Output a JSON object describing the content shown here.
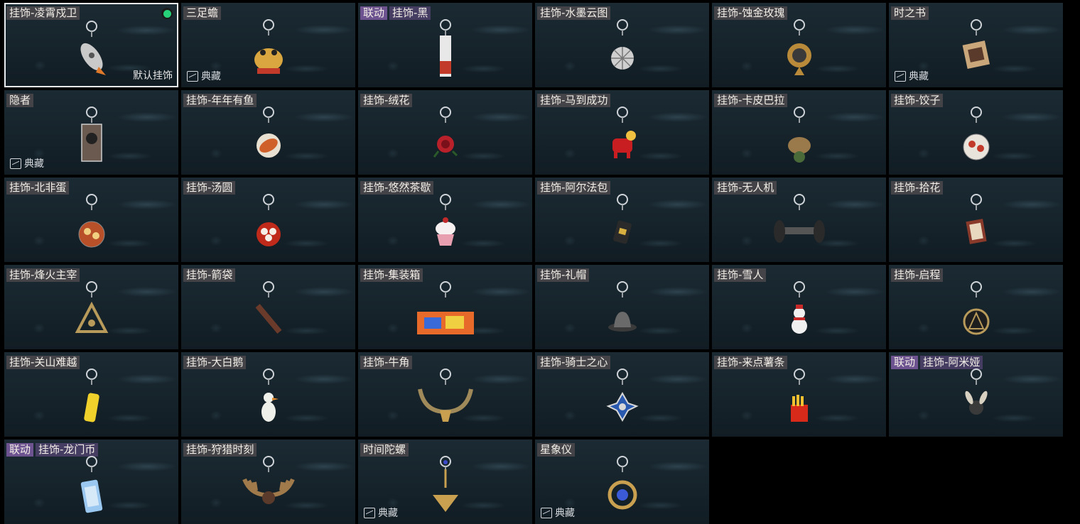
{
  "cards": [
    {
      "label": "挂饰-凌霄戍卫",
      "selected": true,
      "equipped": true,
      "default_label": "默认挂饰",
      "icon": "rocket-charm-icon",
      "color": "#c9c9c9",
      "accent": "#e07a2a",
      "shape": "rocket"
    },
    {
      "label": "三足蟾",
      "corner": "典藏",
      "icon": "golden-toad-charm-icon",
      "color": "#d9a640",
      "accent": "#c23a2a",
      "shape": "toad"
    },
    {
      "collab": "联动",
      "label": "挂饰-黑",
      "icon": "tall-box-charm-icon",
      "color": "#e8e8e8",
      "accent": "#c23a2a",
      "shape": "tall"
    },
    {
      "label": "挂饰-水墨云图",
      "icon": "disco-ball-charm-icon",
      "color": "#cfcfcf",
      "accent": "#777777",
      "shape": "ball"
    },
    {
      "label": "挂饰-蚀金玫瑰",
      "icon": "gold-rose-badge-charm-icon",
      "color": "#b88a3a",
      "accent": "#3a3a3a",
      "shape": "badge"
    },
    {
      "label": "时之书",
      "corner": "典藏",
      "icon": "book-charm-icon",
      "color": "#c9a77a",
      "accent": "#5a3a2a",
      "shape": "book"
    },
    {
      "label": "隐者",
      "corner": "典藏",
      "icon": "hermit-card-charm-icon",
      "color": "#6a5a50",
      "accent": "#222222",
      "shape": "card"
    },
    {
      "label": "挂饰-年年有鱼",
      "icon": "fish-charm-icon",
      "color": "#d0602a",
      "accent": "#f0d0b0",
      "shape": "fish"
    },
    {
      "label": "挂饰-绒花",
      "icon": "red-flower-charm-icon",
      "color": "#b8202a",
      "accent": "#2a5a2a",
      "shape": "flower"
    },
    {
      "label": "挂饰-马到成功",
      "icon": "red-horse-charm-icon",
      "color": "#c81e22",
      "accent": "#f0c040",
      "shape": "horse"
    },
    {
      "label": "挂饰-卡皮巴拉",
      "icon": "capybara-charm-icon",
      "color": "#9a7a4a",
      "accent": "#4a6a3a",
      "shape": "capy"
    },
    {
      "label": "挂饰-饺子",
      "icon": "dumplings-charm-icon",
      "color": "#e8e4dc",
      "accent": "#c23a2a",
      "shape": "plate"
    },
    {
      "label": "挂饰-北非蛋",
      "icon": "shakshuka-charm-icon",
      "color": "#b8502a",
      "accent": "#f0d080",
      "shape": "plate"
    },
    {
      "label": "挂饰-汤圆",
      "icon": "tangyuan-charm-icon",
      "color": "#c02a1a",
      "accent": "#f4efe6",
      "shape": "bowl"
    },
    {
      "label": "挂饰-悠然茶歇",
      "icon": "cupcake-charm-icon",
      "color": "#e8a0b0",
      "accent": "#f6f0f0",
      "shape": "cupcake"
    },
    {
      "label": "挂饰-阿尔法包",
      "icon": "alpha-bag-charm-icon",
      "color": "#2a2a2a",
      "accent": "#d8b040",
      "shape": "bag"
    },
    {
      "label": "挂饰-无人机",
      "icon": "drone-charm-icon",
      "color": "#2a2a2a",
      "accent": "#555555",
      "shape": "drone"
    },
    {
      "label": "挂饰-拾花",
      "icon": "frame-charm-icon",
      "color": "#8a3a2a",
      "accent": "#e8d8c0",
      "shape": "frame"
    },
    {
      "label": "挂饰-烽火主宰",
      "icon": "triangle-emblem-charm-icon",
      "color": "#b89a5a",
      "accent": "#3a3a2a",
      "shape": "triangle"
    },
    {
      "label": "挂饰-箭袋",
      "icon": "quiver-charm-icon",
      "color": "#6a3a2a",
      "accent": "#2a2a2a",
      "shape": "quiver"
    },
    {
      "label": "挂饰-集装箱",
      "icon": "container-charm-icon",
      "color": "#e86a2a",
      "accent": "#3a6ad8",
      "shape": "container"
    },
    {
      "label": "挂饰-礼帽",
      "icon": "top-hat-charm-icon",
      "color": "#6a6a6a",
      "accent": "#3a3a3a",
      "shape": "hat"
    },
    {
      "label": "挂饰-雪人",
      "icon": "snowman-charm-icon",
      "color": "#f0f0f0",
      "accent": "#c82a2a",
      "shape": "snowman"
    },
    {
      "label": "挂饰-启程",
      "icon": "compass-coin-charm-icon",
      "color": "#b89a5a",
      "accent": "#2a2a2a",
      "shape": "coin"
    },
    {
      "label": "挂饰-关山难越",
      "icon": "yellow-can-charm-icon",
      "color": "#f0d02a",
      "accent": "#c8a020",
      "shape": "can"
    },
    {
      "label": "挂饰-大白鹅",
      "icon": "white-goose-charm-icon",
      "color": "#f0f0ea",
      "accent": "#e08a2a",
      "shape": "goose"
    },
    {
      "label": "挂饰-牛角",
      "icon": "horns-charm-icon",
      "color": "#a08a5a",
      "accent": "#3a3020",
      "shape": "horns"
    },
    {
      "label": "挂饰-骑士之心",
      "icon": "knight-cross-charm-icon",
      "color": "#2a5ab0",
      "accent": "#d8d8d8",
      "shape": "cross"
    },
    {
      "label": "挂饰-来点薯条",
      "icon": "fries-charm-icon",
      "color": "#d82a1a",
      "accent": "#f0c030",
      "shape": "fries"
    },
    {
      "collab": "联动",
      "label": "挂饰-阿米娅",
      "icon": "amiya-charm-icon",
      "color": "#3a3a3a",
      "accent": "#d8d0c0",
      "shape": "bunny"
    },
    {
      "collab": "联动",
      "label": "挂饰-龙门币",
      "icon": "lungmen-coin-charm-icon",
      "color": "#9ac8f0",
      "accent": "#ffffff",
      "shape": "tag"
    },
    {
      "label": "挂饰-狩猎时刻",
      "icon": "antlers-charm-icon",
      "color": "#a07a4a",
      "accent": "#5a3a2a",
      "shape": "antlers"
    },
    {
      "label": "时间陀螺",
      "corner": "典藏",
      "icon": "spinning-top-charm-icon",
      "color": "#c8a050",
      "accent": "#3a4ac8",
      "shape": "top"
    },
    {
      "label": "星象仪",
      "corner": "典藏",
      "icon": "astrolabe-charm-icon",
      "color": "#c8a050",
      "accent": "#3a5ad8",
      "shape": "astro"
    }
  ]
}
